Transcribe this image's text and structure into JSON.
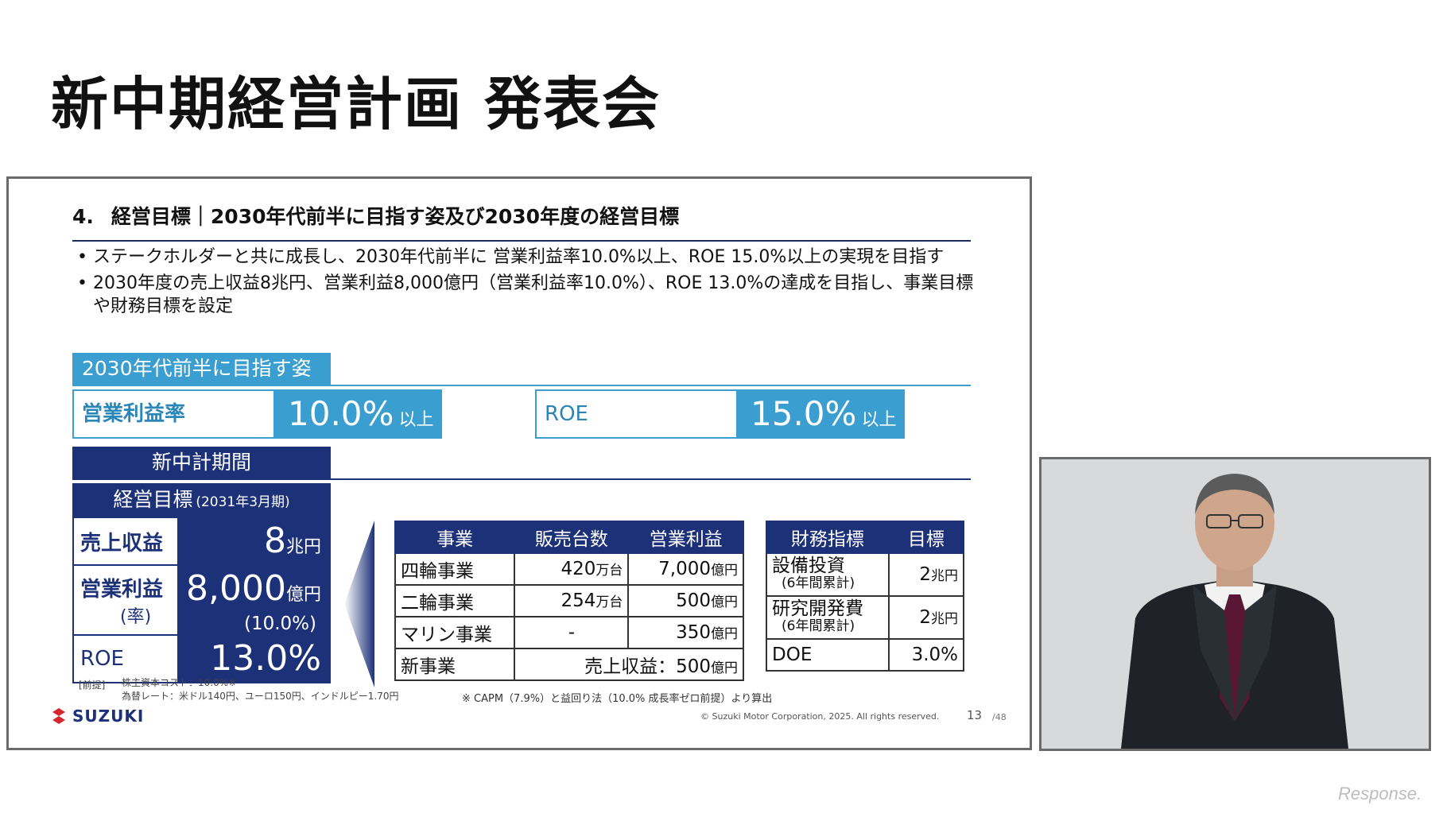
{
  "page_title": "新中期経営計画 発表会",
  "slide": {
    "heading_number": "4.",
    "heading_text": "経営目標｜2030年代前半に目指す姿及び2030年度の経営目標",
    "bullets": [
      "ステークホルダーと共に成長し、2030年代前半に 営業利益率10.0%以上、ROE 15.0%以上の実現を目指す",
      "2030年度の売上収益8兆円、営業利益8,000億円（営業利益率10.0%）、ROE 13.0%の達成を目指し、事業目標や財務目標を設定"
    ],
    "aspiration_label": "2030年代前半に目指す姿",
    "aspiration_kpis": [
      {
        "label": "営業利益率",
        "value": "10.0%",
        "suffix": "以上"
      },
      {
        "label": "ROE",
        "value": "15.0%",
        "suffix": "以上"
      }
    ],
    "period_label": "新中計期間",
    "targets_title": "経営目標",
    "targets_sub": "(2031年3月期)",
    "targets": {
      "revenue": {
        "label": "売上収益",
        "value": "8",
        "unit": "兆円"
      },
      "op_profit": {
        "label": "営業利益",
        "sub": "(率)",
        "value": "8,000",
        "unit": "億円",
        "rate": "(10.0%)"
      },
      "roe": {
        "label": "ROE",
        "value": "13.0%"
      }
    },
    "business_table": {
      "headers": [
        "事業",
        "販売台数",
        "営業利益"
      ],
      "rows": [
        {
          "name": "四輪事業",
          "units": "420",
          "units_unit": "万台",
          "profit": "7,000",
          "profit_unit": "億円"
        },
        {
          "name": "二輪事業",
          "units": "254",
          "units_unit": "万台",
          "profit": "500",
          "profit_unit": "億円"
        },
        {
          "name": "マリン事業",
          "units": "-",
          "units_unit": "",
          "profit": "350",
          "profit_unit": "億円"
        }
      ],
      "new_business": {
        "name": "新事業",
        "text": "売上収益：500",
        "unit": "億円"
      }
    },
    "finance_table": {
      "headers": [
        "財務指標",
        "目標"
      ],
      "rows": [
        {
          "label": "設備投資",
          "sub": "(6年間累計)",
          "value": "2",
          "unit": "兆円"
        },
        {
          "label": "研究開発費",
          "sub": "(6年間累計)",
          "value": "2",
          "unit": "兆円"
        },
        {
          "label": "DOE",
          "sub": "",
          "value": "3.0%",
          "unit": ""
        }
      ]
    },
    "premise_label": "[前提]",
    "premise_cost": "株主資本コスト：10.0%※",
    "premise_fx": "為替レート：米ドル140円、ユーロ150円、インドルピー1.70円",
    "capm_note": "※ CAPM（7.9%）と益回り法（10.0% 成長率ゼロ前提）より算出",
    "logo_text": "SUZUKI",
    "copyright": "© Suzuki Motor Corporation, 2025. All rights reserved.",
    "page_number": "13",
    "page_total": "/48"
  },
  "watermark": "Response."
}
